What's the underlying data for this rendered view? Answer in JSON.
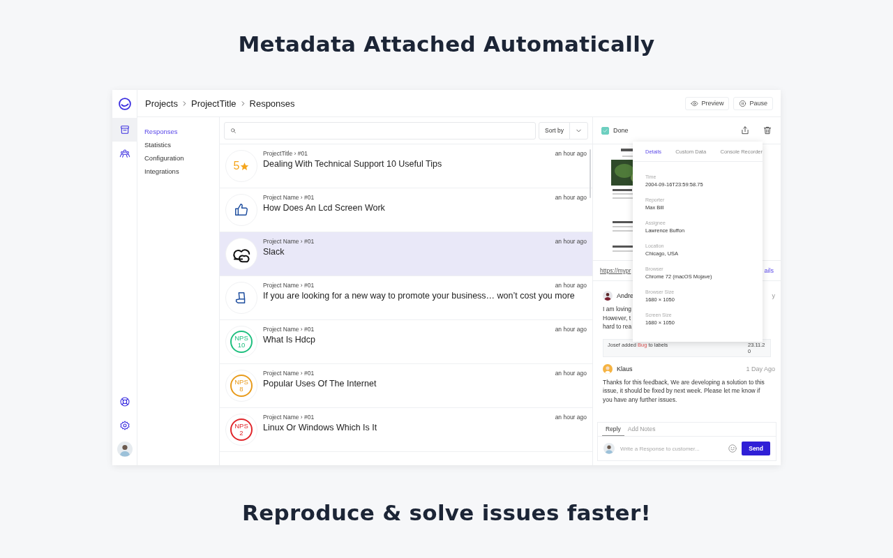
{
  "headline": "Metadata Attached Automatically",
  "footer_headline": "Reproduce & solve issues faster!",
  "rail": {
    "top": [
      {
        "kind": "inbox",
        "selected": true
      },
      {
        "kind": "team",
        "selected": false
      }
    ],
    "bottom": [
      {
        "kind": "help"
      },
      {
        "kind": "settings"
      },
      {
        "kind": "avatar"
      }
    ]
  },
  "breadcrumb": [
    "Projects",
    "ProjectTitle",
    "Responses"
  ],
  "header_buttons": [
    {
      "kind": "preview",
      "label": "Preview"
    },
    {
      "kind": "pause",
      "label": "Pause"
    }
  ],
  "nav": [
    {
      "label": "Responses",
      "selected": true
    },
    {
      "label": "Statistics",
      "selected": false
    },
    {
      "label": "Configuration",
      "selected": false
    },
    {
      "label": "Integrations",
      "selected": false
    }
  ],
  "sort": {
    "label": "Sort by"
  },
  "responses": [
    {
      "kind": "rating",
      "score": "5",
      "meta": "ProjectTitle › #01",
      "title": "Dealing With Technical Support 10 Useful Tips",
      "time": "an hour ago",
      "selected": false
    },
    {
      "kind": "thumb",
      "meta": "Project Name › #01",
      "title": "How Does An Lcd Screen Work",
      "time": "an hour ago",
      "selected": false
    },
    {
      "kind": "cloud",
      "meta": "Project Name › #01",
      "title": "Slack",
      "time": "an hour ago",
      "selected": true
    },
    {
      "kind": "hand",
      "meta": "Project Name › #01",
      "title": "If you are looking for a new way to promote your business… won’t cost you more",
      "time": "an hour ago",
      "selected": false
    },
    {
      "kind": "nps",
      "label": "NPS",
      "score": "10",
      "color": "#1fbf7f",
      "meta": "Project Name › #01",
      "title": "What Is Hdcp",
      "time": "an hour ago",
      "selected": false
    },
    {
      "kind": "nps",
      "label": "NPS",
      "score": "8",
      "color": "#e89b1c",
      "meta": "Project Name › #01",
      "title": "Popular Uses Of The Internet",
      "time": "an hour ago",
      "selected": false
    },
    {
      "kind": "nps",
      "label": "NPS",
      "score": "2",
      "color": "#e0262b",
      "meta": "Project Name › #01",
      "title": "Linux Or Windows Which Is It",
      "time": "an hour ago",
      "selected": false
    }
  ],
  "detail": {
    "done": {
      "label": "Done",
      "checked": true
    },
    "url": "https://mypr",
    "details_link": "ails",
    "comment": {
      "author": "Andre",
      "time": "y",
      "lines": [
        "I am loving",
        "However, t",
        "hard to rea"
      ]
    },
    "activity": {
      "before": "Josef added",
      "label": "Bug",
      "after": "to labels",
      "date": "23.11.20"
    },
    "reply_comment": {
      "author": "Klaus",
      "time": "1 Day Ago",
      "text": "Thanks for this feedback, We are developing a solution to this issue, it should be fixed by next week. Please let me know if you have any further issues."
    },
    "reply_tabs": [
      {
        "label": "Reply",
        "selected": true
      },
      {
        "label": "Add Notes",
        "selected": false
      }
    ],
    "reply_placeholder": "Write a Response to customer...",
    "send": "Send",
    "popover": {
      "tabs": [
        {
          "label": "Details",
          "selected": true
        },
        {
          "label": "Custom Data",
          "selected": false
        },
        {
          "label": "Console Recorder",
          "selected": false
        }
      ],
      "fields": [
        {
          "label": "Time",
          "value": "2004-09-16T23:59:58.75"
        },
        {
          "label": "Reporter",
          "value": "Max Bill"
        },
        {
          "label": "Assignee",
          "value": "Lawrence Buffon"
        },
        {
          "label": "Location",
          "value": "Chicago, USA"
        },
        {
          "label": "Browser",
          "value": "Chrome 72 (macOS Mojave)"
        },
        {
          "label": "Browser Size",
          "value": "1680 × 1050"
        },
        {
          "label": "Screen Size",
          "value": "1680 × 1050"
        }
      ]
    }
  }
}
